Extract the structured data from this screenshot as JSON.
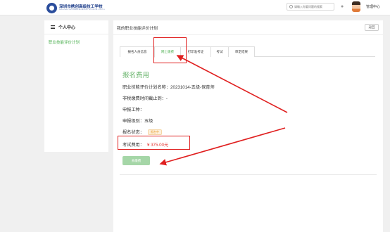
{
  "header": {
    "logo_title": "深圳市携创高级技工学校",
    "logo_subtitle": "SHENZHEN XIECHUANG ADVANCED TECHNICAL SCHOOL",
    "search_placeholder": "请输入你要问题的搜索",
    "user_label": "管理中心"
  },
  "sidebar": {
    "title": "个人中心",
    "items": [
      {
        "label": "职业技能评价计划"
      }
    ]
  },
  "main": {
    "title": "我的职业技能评价计划",
    "back_label": "返回",
    "tabs": [
      {
        "label": "报名人员信息"
      },
      {
        "label": "网上缴费",
        "active": true
      },
      {
        "label": "打印准考证"
      },
      {
        "label": "考试"
      },
      {
        "label": "审定结果"
      }
    ],
    "section_title": "报名费用",
    "plan_name": "职业技能评价计划名称：20231014-五级-保育师",
    "deadline": "非税缴费时间截止到：-",
    "job_type": "申报工种：",
    "level": "申报级别：五级",
    "status_label": "报名状态：",
    "status_value": "报名中",
    "fee_label": "考试费用：",
    "fee_value": "¥ 375.00元",
    "pay_button": "去缴费"
  },
  "colors": {
    "accent_green": "#4caf50",
    "annotation_red": "#e02020",
    "fee_red": "#e53935",
    "status_orange": "#e89a2a"
  }
}
